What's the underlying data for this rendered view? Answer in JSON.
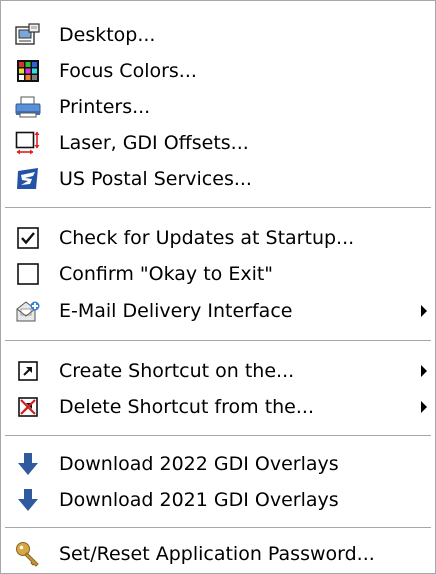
{
  "menu": {
    "items": [
      {
        "label": "Desktop...",
        "icon": "desktop-icon"
      },
      {
        "label": "Focus Colors...",
        "icon": "color-palette-icon"
      },
      {
        "label": "Printers...",
        "icon": "printer-icon"
      },
      {
        "label": "Laser, GDI Offsets...",
        "icon": "offsets-icon"
      },
      {
        "label": "US Postal Services...",
        "icon": "usps-eagle-icon"
      },
      {
        "label": "Check for Updates at Startup...",
        "icon": "checkbox-checked-icon"
      },
      {
        "label": "Confirm \"Okay to Exit\"",
        "icon": "checkbox-unchecked-icon"
      },
      {
        "label": "E-Mail Delivery Interface",
        "icon": "email-icon",
        "submenu": true
      },
      {
        "label": "Create Shortcut on the...",
        "icon": "shortcut-create-icon",
        "submenu": true
      },
      {
        "label": "Delete Shortcut from the...",
        "icon": "shortcut-delete-icon",
        "submenu": true
      },
      {
        "label": "Download 2022 GDI Overlays",
        "icon": "download-arrow-icon"
      },
      {
        "label": "Download 2021 GDI Overlays",
        "icon": "download-arrow-icon"
      },
      {
        "label": "Set/Reset Application Password...",
        "icon": "key-icon"
      }
    ]
  },
  "colors": {
    "separator": "#a7a6aa",
    "download_arrow": "#2f5b9e",
    "key": "#c79a3a"
  }
}
